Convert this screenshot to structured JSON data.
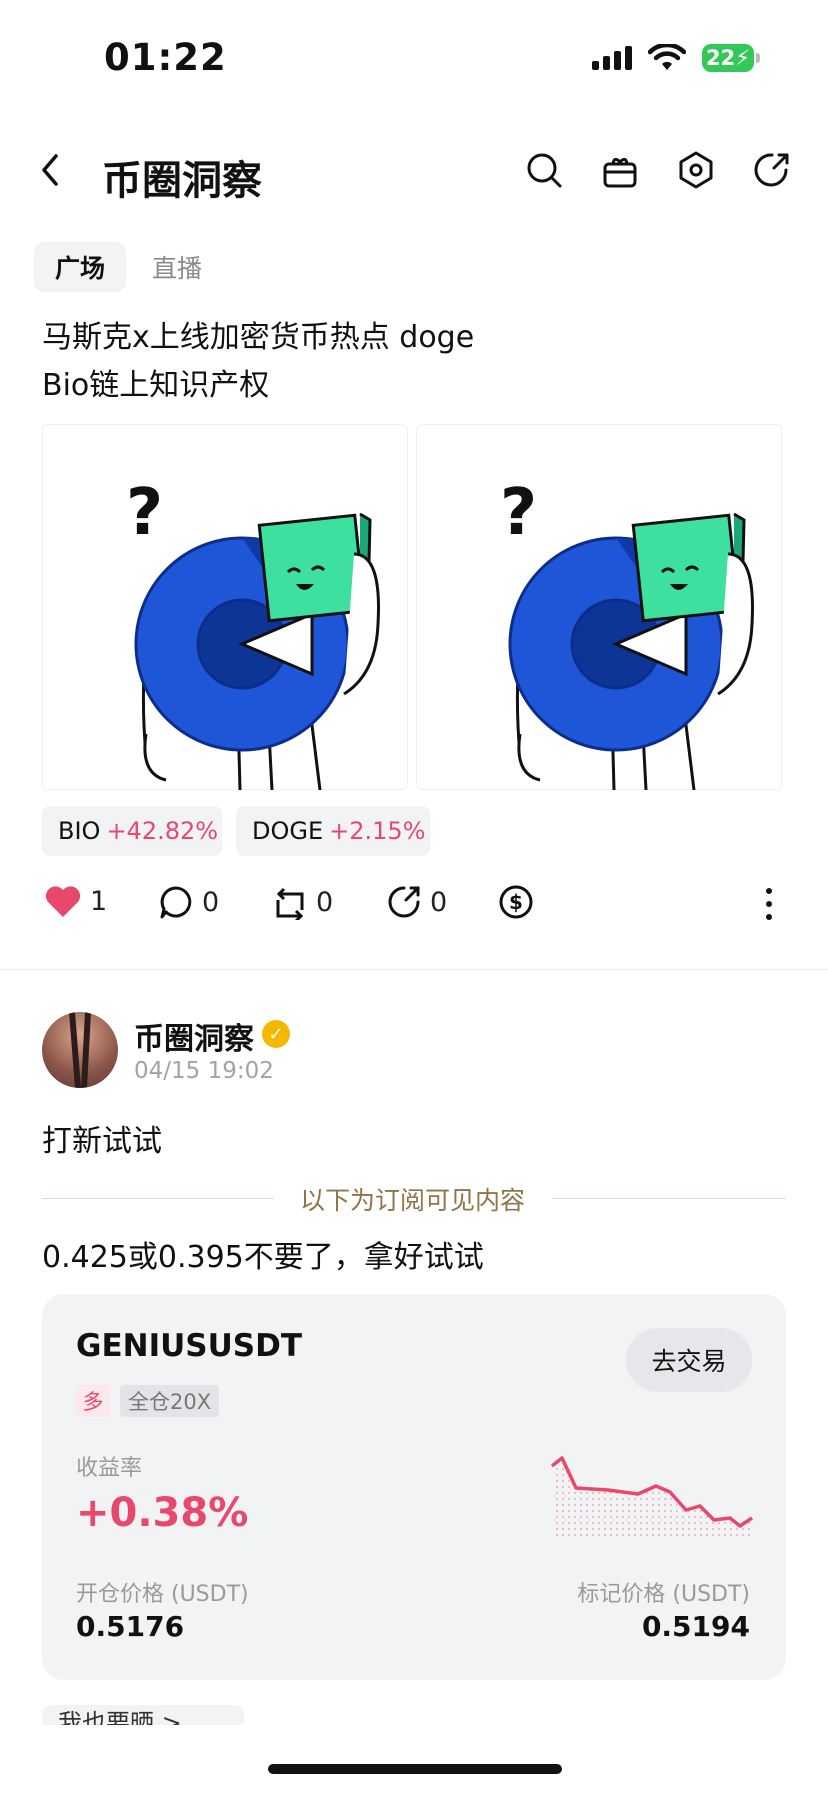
{
  "status_bar": {
    "time": "01:22",
    "battery": "22"
  },
  "header": {
    "title": "币圈洞察"
  },
  "tabs": [
    {
      "label": "广场"
    },
    {
      "label": "直播"
    }
  ],
  "post1": {
    "text_line1": "马斯克x上线加密货币热点 doge",
    "text_line2": "Bio链上知识产权",
    "tokens": [
      {
        "symbol": "BIO",
        "change": "+42.82%"
      },
      {
        "symbol": "DOGE",
        "change": "+2.15%"
      }
    ],
    "actions": {
      "likes": "1",
      "comments": "0",
      "reposts": "0",
      "shares": "0"
    }
  },
  "post2": {
    "author": "币圈洞察",
    "date": "04/15 19:02",
    "text": "打新试试",
    "subscription_label": "以下为订阅可见内容",
    "sub_text": "0.425或0.395不要了，拿好试试",
    "trade_card": {
      "pair": "GENIUSUSDT",
      "button": "去交易",
      "direction": "多",
      "leverage": "全仓20X",
      "pnl_label": "收益率",
      "pnl": "+0.38%",
      "open_price_label": "开仓价格 (USDT)",
      "open_price": "0.5176",
      "mark_price_label": "标记价格 (USDT)",
      "mark_price": "0.5194"
    },
    "more_chip": "我也要晒 >"
  },
  "colors": {
    "up": "#e8486b",
    "accent_gold": "#f5b800",
    "mascot_blue": "#1f56d8",
    "mascot_green": "#3ee0a0"
  }
}
